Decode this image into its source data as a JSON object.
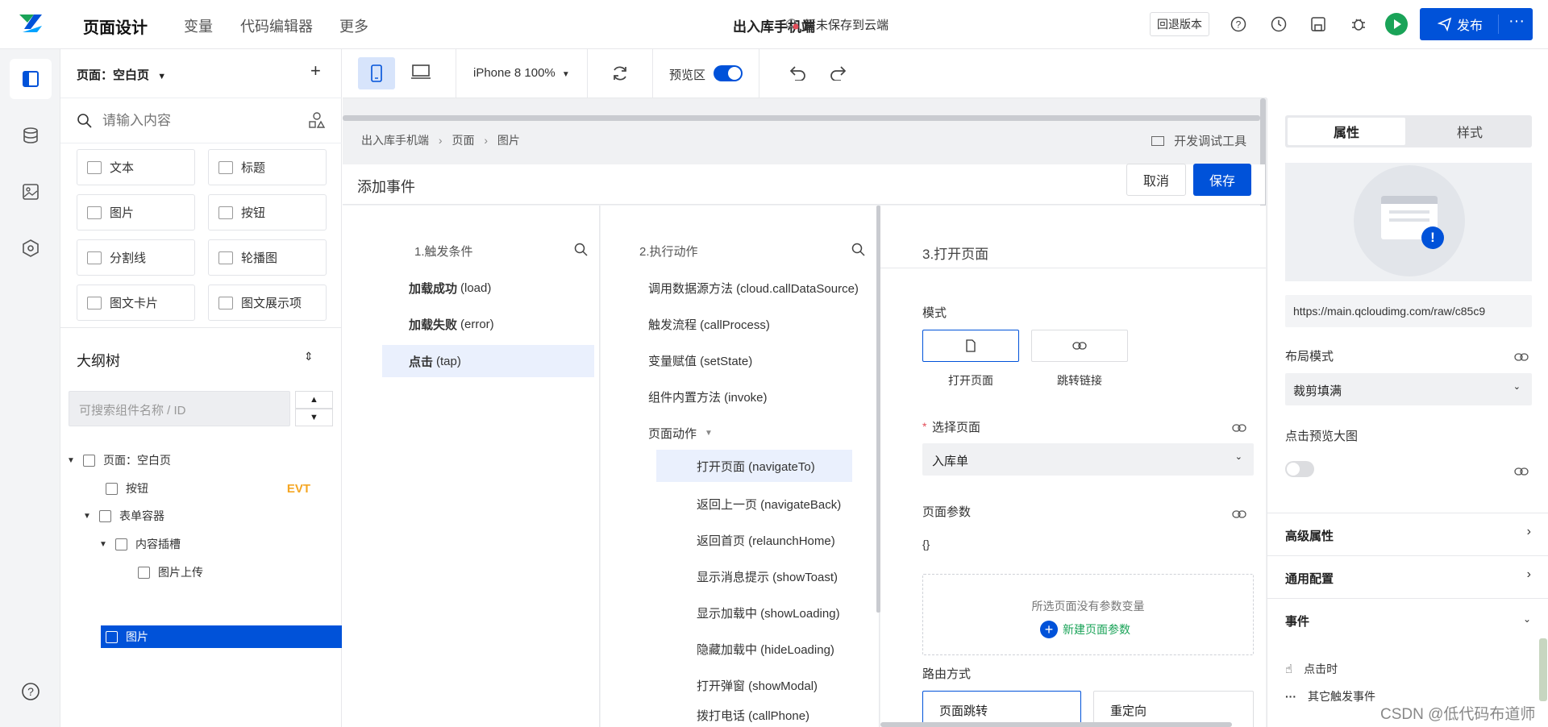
{
  "header": {
    "app_title": "页面设计",
    "nav": [
      "变量",
      "代码编辑器",
      "更多"
    ],
    "page_name": "出入库手机端",
    "save_status": "暂未保存到云端",
    "rollback_label": "回退版本",
    "publish_label": "发布",
    "more_label": "···"
  },
  "left_panel": {
    "page_selector": "页面：空白页",
    "add_label": "+",
    "search_placeholder": "请输入内容",
    "components": [
      {
        "label": "文本"
      },
      {
        "label": "标题"
      },
      {
        "label": "图片"
      },
      {
        "label": "按钮"
      },
      {
        "label": "分割线"
      },
      {
        "label": "轮播图"
      },
      {
        "label": "图文卡片"
      },
      {
        "label": "图文展示项"
      }
    ],
    "outline": {
      "title": "大纲树",
      "search_placeholder": "可搜索组件名称 / ID",
      "nodes": [
        {
          "label": "页面：空白页",
          "badge": ""
        },
        {
          "label": "按钮",
          "badge": "EVT"
        },
        {
          "label": "表单容器",
          "badge": ""
        },
        {
          "label": "内容插槽",
          "badge": ""
        },
        {
          "label": "图片上传",
          "badge": ""
        },
        {
          "label": "图片",
          "badge": ""
        }
      ]
    }
  },
  "toolbar": {
    "device_label": "iPhone 8 100%",
    "preview_label": "预览区",
    "preview_enabled": true
  },
  "workspace": {
    "breadcrumb": [
      "出入库手机端",
      "页面",
      "图片"
    ],
    "dev_tools_label": "开发调试工具",
    "event_title": "添加事件",
    "cancel_label": "取消",
    "save_label": "保存"
  },
  "trigger": {
    "title": "1.触发条件",
    "options": [
      {
        "name": "加载成功",
        "code": "(load)"
      },
      {
        "name": "加载失败",
        "code": "(error)"
      },
      {
        "name": "点击",
        "code": "(tap)"
      }
    ]
  },
  "actions": {
    "title": "2.执行动作",
    "items": [
      "调用数据源方法 (cloud.callDataSource)",
      "触发流程 (callProcess)",
      "变量赋值 (setState)",
      "组件内置方法 (invoke)"
    ],
    "group_label": "页面动作",
    "sub_items": [
      "打开页面 (navigateTo)",
      "返回上一页 (navigateBack)",
      "返回首页 (relaunchHome)",
      "显示消息提示 (showToast)",
      "显示加载中 (showLoading)",
      "隐藏加载中 (hideLoading)",
      "打开弹窗 (showModal)",
      "拨打电话 (callPhone)"
    ]
  },
  "config": {
    "title": "3.打开页面",
    "mode_label": "模式",
    "mode_options": [
      "打开页面",
      "跳转链接"
    ],
    "select_page_label": "选择页面",
    "required_mark": "*",
    "selected_page": "入库单",
    "params_label": "页面参数",
    "params_value": "{}",
    "no_params_text": "所选页面没有参数变量",
    "new_param_label": "新建页面参数",
    "route_label": "路由方式",
    "route_options": [
      "页面跳转",
      "重定向"
    ]
  },
  "properties": {
    "tabs": [
      "属性",
      "样式"
    ],
    "image_url": "https://main.qcloudimg.com/raw/c85c9",
    "layout_label": "布局模式",
    "layout_value": "裁剪填满",
    "preview_large_label": "点击预览大图",
    "preview_large_enabled": false,
    "sections": [
      "高级属性",
      "通用配置",
      "事件"
    ],
    "events": [
      "点击时",
      "其它触发事件"
    ]
  },
  "watermark": "CSDN @低代码布道师",
  "colors": {
    "primary": "#0052d9",
    "selected_bg": "#eaf0fd",
    "badge": "#f5a623",
    "green": "#1aa358"
  }
}
